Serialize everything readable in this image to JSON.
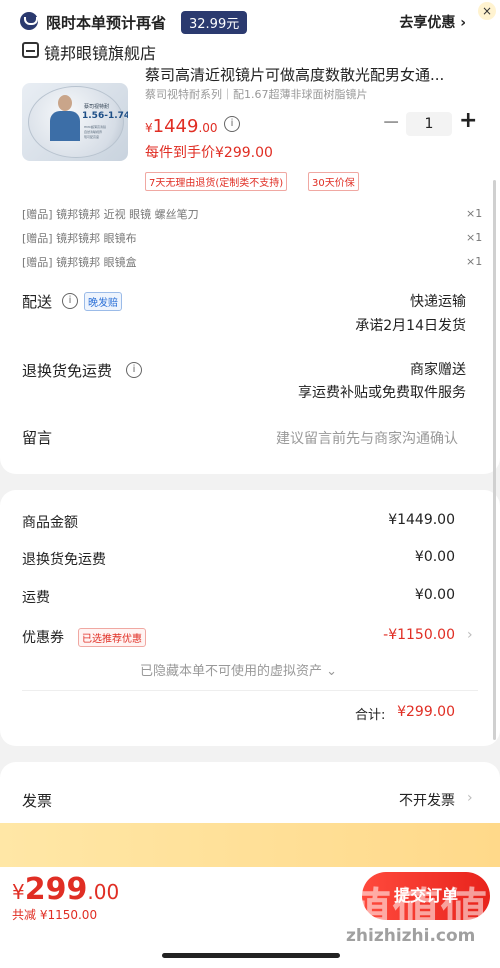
{
  "store": {
    "name": "镜邦眼镜旗舰店"
  },
  "product": {
    "title": "蔡司高清近视镜片可做高度数散光配男女通...",
    "spec": "蔡司视特耐系列｜配1.67超薄非球面树脂镜片",
    "currency": "¥",
    "price_int": "1449",
    "price_dec": ".00",
    "quantity": "1",
    "final_price": "每件到手价¥299.00",
    "tags": [
      "7天无理由退货(定制类不支持)",
      "30天价保"
    ],
    "image_text": {
      "series": "蔡司视特耐",
      "range": "1.56-1.74",
      "lines": [
        "HMC超薄高清镜",
        "自然清晰视界",
        "现可配高度"
      ]
    }
  },
  "gifts": [
    {
      "label": "[赠品] 镜邦镜邦 近视 眼镜 螺丝笔刀",
      "qty": "×1"
    },
    {
      "label": "[赠品] 镜邦镜邦 眼镜布",
      "qty": "×1"
    },
    {
      "label": "[赠品] 镜邦镜邦 眼镜盒",
      "qty": "×1"
    }
  ],
  "delivery": {
    "label": "配送",
    "badge": "晚发赔",
    "method": "快递运输",
    "promise": "承诺2月14日发货"
  },
  "return_shipping": {
    "label": "退换货免运费",
    "value1": "商家赠送",
    "value2": "享运费补贴或免费取件服务"
  },
  "message": {
    "label": "留言",
    "placeholder": "建议留言前先与商家沟通确认"
  },
  "summary": {
    "goods_label": "商品金额",
    "goods_value": "¥1449.00",
    "return_label": "退换货免运费",
    "return_value": "¥0.00",
    "shipping_label": "运费",
    "shipping_value": "¥0.00",
    "coupon_label": "优惠券",
    "coupon_badge": "已选推荐优惠",
    "coupon_value": "-¥1150.00",
    "hidden_assets": "已隐藏本单不可使用的虚拟资产 ⌄",
    "total_label": "合计:",
    "total_value": "¥299.00"
  },
  "invoice": {
    "label": "发票",
    "value": "不开发票"
  },
  "promo": {
    "text": "限时本单预计再省",
    "amount": "32.99元",
    "action": "去享优惠 ›",
    "close": "×"
  },
  "bottom": {
    "currency": "¥",
    "price_int": "299",
    "price_dec": ".00",
    "saved": "共减 ¥1150.00",
    "submit": "提交订单"
  },
  "watermark": {
    "text": "値値値",
    "url": "zhizhizhi.com"
  },
  "colors": {
    "accent": "#e02e24",
    "promo_bg": "#ffe7a6",
    "promo_dark": "#2b3a6f"
  }
}
